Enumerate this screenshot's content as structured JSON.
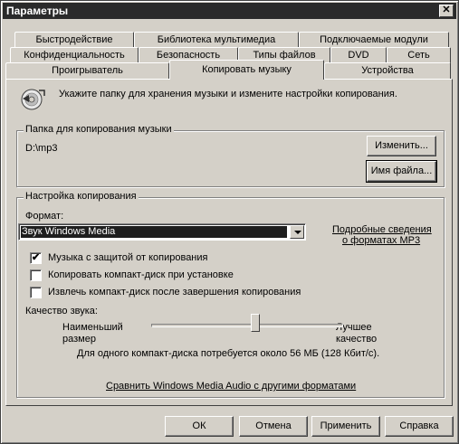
{
  "window": {
    "title": "Параметры",
    "close_label": "✕"
  },
  "tabs": {
    "row1": [
      "Быстродействие",
      "Библиотека мультимедиа",
      "Подключаемые модули"
    ],
    "row2": [
      "Конфиденциальность",
      "Безопасность",
      "Типы файлов",
      "DVD",
      "Сеть"
    ],
    "row3": [
      "Проигрыватель",
      "Копировать музыку",
      "Устройства"
    ],
    "active": "Копировать музыку"
  },
  "intro": {
    "icon": "cd-rip-icon",
    "text": "Укажите папку для хранения музыки и измените настройки копирования."
  },
  "folder_group": {
    "legend": "Папка для копирования музыки",
    "path": "D:\\mp3",
    "change_button": "Изменить...",
    "filename_button": "Имя файла..."
  },
  "settings_group": {
    "legend": "Настройка копирования",
    "format_label": "Формат:",
    "format_value": "Звук Windows Media",
    "mp3_link_line1": "Подробные сведения",
    "mp3_link_line2": "о форматах MP3",
    "checkboxes": [
      {
        "label": "Музыка с защитой от копирования",
        "checked": true
      },
      {
        "label": "Копировать компакт-диск при установке",
        "checked": false
      },
      {
        "label": "Извлечь компакт-диск после завершения копирования",
        "checked": false
      }
    ],
    "quality_label": "Качество звука:",
    "quality_min_line1": "Наименьший",
    "quality_min_line2": "размер",
    "quality_max_line1": "Лучшее",
    "quality_max_line2": "качество",
    "quality_info": "Для одного компакт-диска потребуется около 56 МБ (128 Кбит/с).",
    "quality_level": 0.55
  },
  "compare_link": "Сравнить Windows Media Audio с другими форматами",
  "footer": {
    "ok": "ОК",
    "cancel": "Отмена",
    "apply": "Применить",
    "help": "Справка"
  }
}
